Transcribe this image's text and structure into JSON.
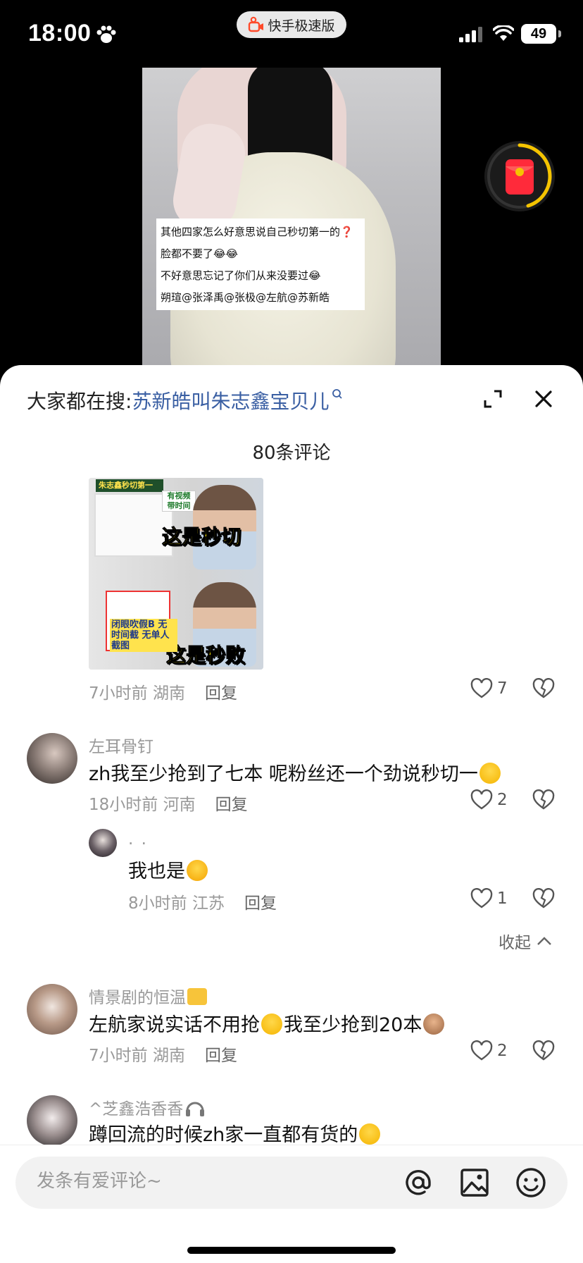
{
  "status_bar": {
    "time": "18:00",
    "app_pill": "快手极速版",
    "battery": "49"
  },
  "video": {
    "caption_lines": [
      "其他四家怎么好意思说自己秒切第一的❓",
      "脸都不要了😂😂",
      "不好意思忘记了你们从来没要过😂",
      "朔瑄@张泽禹@张极@左航@苏新皓"
    ]
  },
  "sheet": {
    "search_prefix": "大家都在搜:",
    "search_term": "苏新皓叫朱志鑫宝贝儿",
    "comment_count": "80条评论"
  },
  "meme": {
    "top_banner": "朱志鑫秒切第一",
    "top_note": "有视频 带时间",
    "top_caption": "这是秒切",
    "bottom_box": "闭眼吹假B 无时间截 无单人截图",
    "bottom_caption": "这是秒败"
  },
  "comments": [
    {
      "meta": "7小时前 湖南",
      "reply": "回复",
      "likes": "7"
    },
    {
      "user": "左耳骨钉",
      "text": "zh我至少抢到了七本 呢粉丝还一个劲说秒切一",
      "meta": "18小时前 河南",
      "reply": "回复",
      "likes": "2"
    },
    {
      "user": ".          .",
      "text": "我也是",
      "meta": "8小时前 江苏",
      "reply": "回复",
      "likes": "1"
    },
    {
      "user": "情景剧的恒温",
      "text_a": "左航家说实话不用抢",
      "text_b": "我至少抢到20本",
      "meta": "7小时前 湖南",
      "reply": "回复",
      "likes": "2"
    },
    {
      "user": "^芝鑫浩香香",
      "text": "蹲回流的时候zh家一直都有货的"
    }
  ],
  "collapse_label": "收起",
  "composer": {
    "placeholder": "发条有爱评论~"
  },
  "icons": [
    "paw-icon",
    "signal-icon",
    "wifi-icon",
    "red-envelope-icon",
    "expand-icon",
    "close-icon",
    "heart-icon",
    "dislike-heart-icon",
    "chevron-up-icon",
    "at-icon",
    "image-icon",
    "emoji-icon"
  ],
  "colors": {
    "accent_link": "#3a5fa3",
    "reward_ring": "#f5c400",
    "reward_red": "#ff2a3a"
  }
}
